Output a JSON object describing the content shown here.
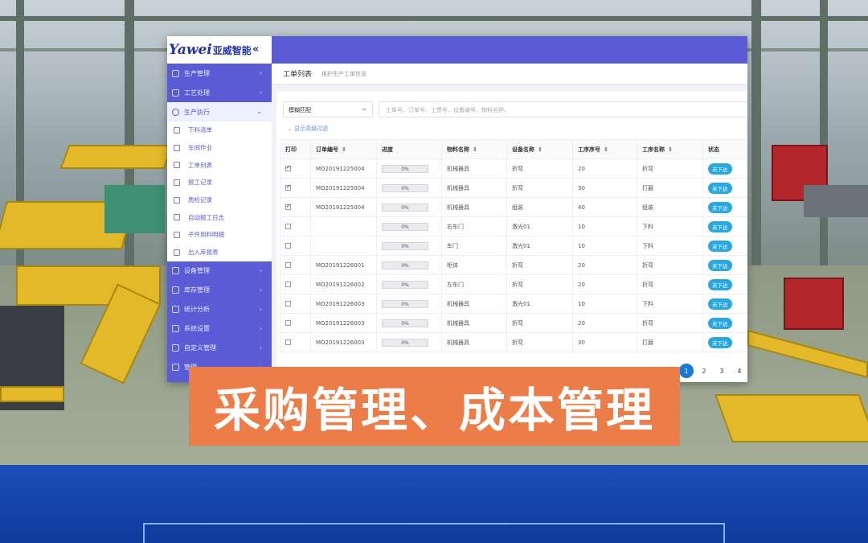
{
  "app": {
    "logo_brand": "Yawei",
    "logo_cn": "亚威智能",
    "collapse_icon": "double-chevron-left-icon"
  },
  "sidebar": {
    "items": [
      {
        "label": "生产管理"
      },
      {
        "label": "工艺处理"
      },
      {
        "label": "生产执行",
        "active": true
      },
      {
        "label": "设备管理"
      },
      {
        "label": "库存管理"
      },
      {
        "label": "统计分析"
      },
      {
        "label": "系统设置"
      },
      {
        "label": "自定义管理"
      },
      {
        "label": "管理"
      }
    ],
    "sub_items": [
      {
        "label": "下料清单"
      },
      {
        "label": "车间作业"
      },
      {
        "label": "工单列表"
      },
      {
        "label": "报工记录"
      },
      {
        "label": "质检记录"
      },
      {
        "label": "自动报工日志"
      },
      {
        "label": "子件用料明细"
      },
      {
        "label": "出入库报表"
      }
    ]
  },
  "header": {
    "page_title": "工单列表",
    "page_subtitle": "维护生产工单信息"
  },
  "filters": {
    "match_mode": "模糊匹配",
    "search_placeholder": "工单号、订单号、工票号、设备编号、物料名称、",
    "advanced_toggle": "⌄ 显示高级过滤"
  },
  "table": {
    "columns": [
      "打印",
      "订单编号",
      "进度",
      "物料名称",
      "设备名称",
      "工序序号",
      "工序名称",
      "状态"
    ],
    "rows": [
      {
        "checked": true,
        "order": "MO20191225004",
        "progress": "0%",
        "material": "机械器具",
        "device": "折弯",
        "seq": "20",
        "process": "折弯",
        "status": "未下达"
      },
      {
        "checked": true,
        "order": "MO20191225004",
        "progress": "0%",
        "material": "机械器具",
        "device": "折弯",
        "seq": "30",
        "process": "打磨",
        "status": "未下达"
      },
      {
        "checked": true,
        "order": "MO20191225004",
        "progress": "0%",
        "material": "机械器具",
        "device": "组装",
        "seq": "40",
        "process": "组装",
        "status": "未下达"
      },
      {
        "checked": false,
        "order": "",
        "progress": "0%",
        "material": "右车门",
        "device": "激光01",
        "seq": "10",
        "process": "下料",
        "status": "未下达"
      },
      {
        "checked": false,
        "order": "",
        "progress": "0%",
        "material": "车门",
        "device": "激光01",
        "seq": "10",
        "process": "下料",
        "status": "未下达"
      },
      {
        "checked": false,
        "order": "MO20191226001",
        "progress": "0%",
        "material": "柜体",
        "device": "折弯",
        "seq": "20",
        "process": "折弯",
        "status": "未下达"
      },
      {
        "checked": false,
        "order": "MO20191226002",
        "progress": "0%",
        "material": "左车门",
        "device": "折弯",
        "seq": "20",
        "process": "折弯",
        "status": "未下达"
      },
      {
        "checked": false,
        "order": "MO20191226003",
        "progress": "0%",
        "material": "机械器具",
        "device": "激光01",
        "seq": "10",
        "process": "下料",
        "status": "未下达"
      },
      {
        "checked": false,
        "order": "MO20191226003",
        "progress": "0%",
        "material": "机械器具",
        "device": "折弯",
        "seq": "20",
        "process": "折弯",
        "status": "未下达"
      },
      {
        "checked": false,
        "order": "MO20191226003",
        "progress": "0%",
        "material": "机械器具",
        "device": "折弯",
        "seq": "30",
        "process": "打磨",
        "status": "未下达"
      }
    ]
  },
  "pagination": {
    "pages": [
      "1",
      "2",
      "3",
      "4"
    ],
    "current": "1"
  },
  "caption": {
    "text": "采购管理、成本管理"
  },
  "colors": {
    "sidebar": "#5b5bd6",
    "status_badge": "#29a8e0",
    "caption_bg": "#ec7c48",
    "banner": "#1b4fb8"
  }
}
